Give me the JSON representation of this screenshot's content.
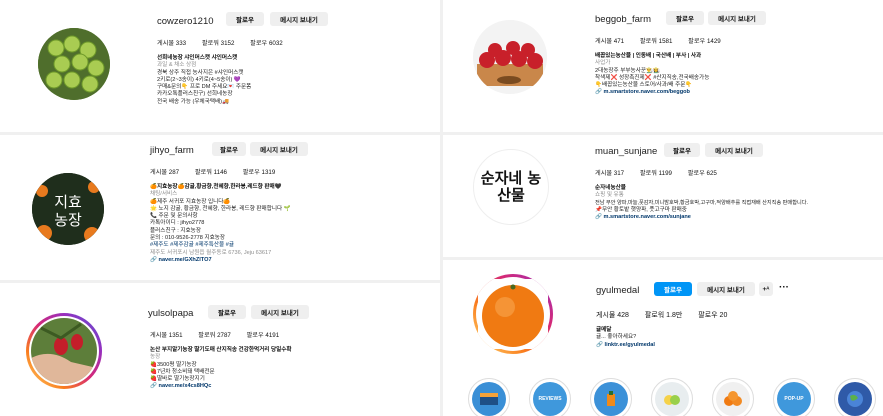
{
  "common": {
    "follow": "팔로우",
    "message": "메시지 보내기"
  },
  "profiles": [
    {
      "username": "cowzero1210",
      "stats": [
        "게시물 333",
        "팔로워 3152",
        "팔로우 6032"
      ],
      "bio": {
        "name": "선희네농장 샤인머스캣 샤인머스캣",
        "category": "과일 & 채소 상점",
        "lines": [
          "경북 상주 직접 농사지은 #샤인머스캣",
          "2키로(2~3송이) 4키로(4~5송이) 💜",
          "구매&문의👇 프로 DM 주세요💌 주문폼",
          "카카오톡플러스친구) 선희네농장",
          "전국 배송 가능 (우체국택배)🚚"
        ]
      }
    },
    {
      "username": "beggob_farm",
      "stats": [
        "게시물 471",
        "팔로워 1581",
        "팔로우 1429"
      ],
      "bio": {
        "name": "배꼽있는농산물 | 인동배 | 국산배 | 부사 | 사과",
        "category": "사업가",
        "lines": [
          "2대농장주 부부농사꾼👨‍🌾👩‍🌾",
          "착색제❌ 성장촉진제❌ #산지직송,전국배송가능",
          "👇배꼽있는농산물 스토어/사과/배 주문👇"
        ],
        "link": "m.smartstore.naver.com/beggob"
      }
    },
    {
      "username": "jihyo_farm",
      "stats": [
        "게시물 287",
        "팔로워 1146",
        "팔로우 1319"
      ],
      "bio": {
        "name": "🍊지효농장🍊감귤,황금향,천혜향,한라봉,레드향 판매🖤",
        "category": "채팅/서비스",
        "lines": [
          "🍊제주 서귀포 지효농장 입니다🍊",
          "🌟 노지 감귤, 황금향, 천혜향, 한라봉, 레드향 판매합니다 🌱",
          "📞 주문 및 문의사항",
          "카톡아이디 : jihyo2778",
          "플러스친구 : 지효농장",
          "문의 : 010-9526-2778 지효농장"
        ],
        "tags": "#제주도 #제주감귤 #제주특산물 #귤",
        "address": "제주도 서귀포시 남원읍 월주동로 6736, Jeju 63617",
        "link": "naver.me/GXhZlTO7"
      }
    },
    {
      "username": "muan_sunjane",
      "stats": [
        "게시물 317",
        "팔로워 1199",
        "팔로우 625"
      ],
      "bio": {
        "name": "순자네농산물",
        "category": "쇼핑 및 유통",
        "lines": [
          "전남 무안 양파,마늘,풋감자,미니밤호박,황금호박,고구마,적양배추를 직접재배 산지직송 판매합니다.",
          "📌무안 황토밭 햇양파, 풋고구마 판매중"
        ],
        "link": "m.smartstore.naver.com/sunjane",
        "avatar_text": "순자네 농산물"
      }
    },
    {
      "username": "yulsolpapa",
      "stats": [
        "게시물 1351",
        "팔로워 2787",
        "팔로우 4191"
      ],
      "bio": {
        "name": "논산 부지알기농장 딸기도매 산지직송 건강한먹거리 당일수확",
        "category": "농장",
        "lines": [
          "🍓3500평 딸기농장",
          "🍓7년차 청소비돼 택배전문",
          "🍓딸바로 딸기농장지기"
        ],
        "link": "naver.me/x4cs8HQc"
      }
    },
    {
      "username": "gyulmedal",
      "follow_label": "팔로우",
      "message_label": "메시지 보내기",
      "stats": [
        "게시물 428",
        "팔로워 1.8만",
        "팔로우 20"
      ],
      "bio": {
        "name": "귤메달",
        "lines": [
          "귤... 좋아하세요?"
        ],
        "link": "linktr.ee/gyulmedal"
      },
      "highlights": [
        "",
        "REVIEWS",
        "",
        "",
        "POP-UP",
        ""
      ]
    }
  ],
  "colors": {
    "accent": "#0095f6",
    "link": "#00376b",
    "muted": "#8e8e8e"
  }
}
